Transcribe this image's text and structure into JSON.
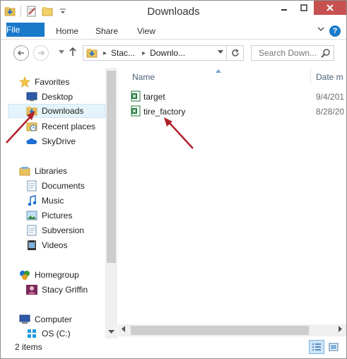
{
  "window": {
    "title": "Downloads"
  },
  "ribbon": {
    "tabs": [
      {
        "label": "File"
      },
      {
        "label": "Home"
      },
      {
        "label": "Share"
      },
      {
        "label": "View"
      }
    ],
    "help_label": "?"
  },
  "address": {
    "crumbs": [
      "Stac...",
      "Downlo..."
    ],
    "search_placeholder": "Search Down..."
  },
  "nav": {
    "favorites": {
      "label": "Favorites",
      "items": [
        {
          "label": "Desktop",
          "icon": "desktop-icon"
        },
        {
          "label": "Downloads",
          "icon": "downloads-folder-icon",
          "selected": true
        },
        {
          "label": "Recent places",
          "icon": "recent-places-icon"
        },
        {
          "label": "SkyDrive",
          "icon": "skydrive-icon"
        }
      ]
    },
    "libraries": {
      "label": "Libraries",
      "items": [
        {
          "label": "Documents",
          "icon": "documents-icon"
        },
        {
          "label": "Music",
          "icon": "music-icon"
        },
        {
          "label": "Pictures",
          "icon": "pictures-icon"
        },
        {
          "label": "Subversion",
          "icon": "subversion-icon"
        },
        {
          "label": "Videos",
          "icon": "videos-icon"
        }
      ]
    },
    "homegroup": {
      "label": "Homegroup",
      "items": [
        {
          "label": "Stacy Griffin",
          "icon": "user-avatar-icon"
        }
      ]
    },
    "computer": {
      "label": "Computer",
      "items": [
        {
          "label": "OS (C:)",
          "icon": "drive-icon"
        }
      ]
    }
  },
  "content": {
    "columns": {
      "name": "Name",
      "date": "Date m"
    },
    "files": [
      {
        "name": "target",
        "date": "9/4/201",
        "icon": "excel-file-icon"
      },
      {
        "name": "tire_factory",
        "date": "8/28/20",
        "icon": "excel-file-icon"
      }
    ]
  },
  "status": {
    "item_count": "2 items"
  },
  "colors": {
    "accent": "#1979ca",
    "close": "#c75050",
    "arrow": "#b0212a",
    "selection": "#e5f3fb"
  }
}
